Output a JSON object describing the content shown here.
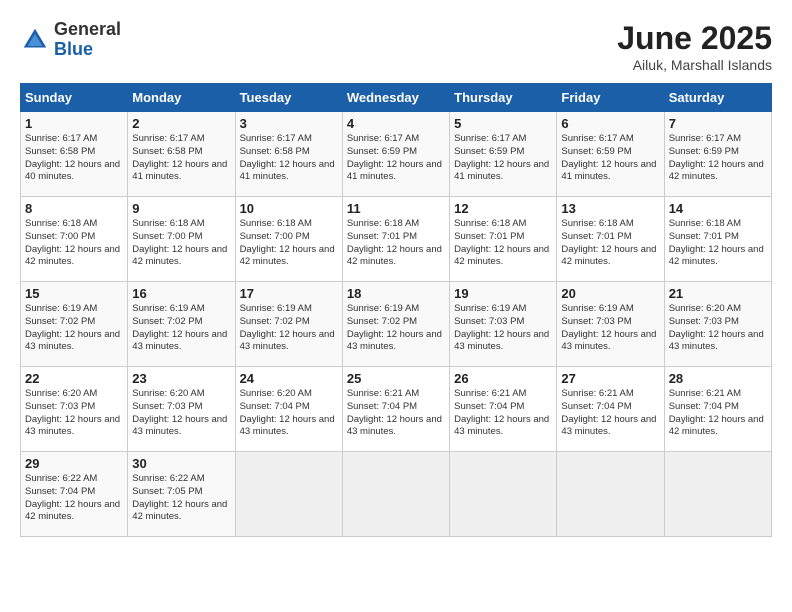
{
  "logo": {
    "general": "General",
    "blue": "Blue"
  },
  "header": {
    "title": "June 2025",
    "subtitle": "Ailuk, Marshall Islands"
  },
  "weekdays": [
    "Sunday",
    "Monday",
    "Tuesday",
    "Wednesday",
    "Thursday",
    "Friday",
    "Saturday"
  ],
  "weeks": [
    [
      {
        "day": "1",
        "sunrise": "6:17 AM",
        "sunset": "6:58 PM",
        "daylight": "12 hours and 40 minutes."
      },
      {
        "day": "2",
        "sunrise": "6:17 AM",
        "sunset": "6:58 PM",
        "daylight": "12 hours and 41 minutes."
      },
      {
        "day": "3",
        "sunrise": "6:17 AM",
        "sunset": "6:58 PM",
        "daylight": "12 hours and 41 minutes."
      },
      {
        "day": "4",
        "sunrise": "6:17 AM",
        "sunset": "6:59 PM",
        "daylight": "12 hours and 41 minutes."
      },
      {
        "day": "5",
        "sunrise": "6:17 AM",
        "sunset": "6:59 PM",
        "daylight": "12 hours and 41 minutes."
      },
      {
        "day": "6",
        "sunrise": "6:17 AM",
        "sunset": "6:59 PM",
        "daylight": "12 hours and 41 minutes."
      },
      {
        "day": "7",
        "sunrise": "6:17 AM",
        "sunset": "6:59 PM",
        "daylight": "12 hours and 42 minutes."
      }
    ],
    [
      {
        "day": "8",
        "sunrise": "6:18 AM",
        "sunset": "7:00 PM",
        "daylight": "12 hours and 42 minutes."
      },
      {
        "day": "9",
        "sunrise": "6:18 AM",
        "sunset": "7:00 PM",
        "daylight": "12 hours and 42 minutes."
      },
      {
        "day": "10",
        "sunrise": "6:18 AM",
        "sunset": "7:00 PM",
        "daylight": "12 hours and 42 minutes."
      },
      {
        "day": "11",
        "sunrise": "6:18 AM",
        "sunset": "7:01 PM",
        "daylight": "12 hours and 42 minutes."
      },
      {
        "day": "12",
        "sunrise": "6:18 AM",
        "sunset": "7:01 PM",
        "daylight": "12 hours and 42 minutes."
      },
      {
        "day": "13",
        "sunrise": "6:18 AM",
        "sunset": "7:01 PM",
        "daylight": "12 hours and 42 minutes."
      },
      {
        "day": "14",
        "sunrise": "6:18 AM",
        "sunset": "7:01 PM",
        "daylight": "12 hours and 42 minutes."
      }
    ],
    [
      {
        "day": "15",
        "sunrise": "6:19 AM",
        "sunset": "7:02 PM",
        "daylight": "12 hours and 43 minutes."
      },
      {
        "day": "16",
        "sunrise": "6:19 AM",
        "sunset": "7:02 PM",
        "daylight": "12 hours and 43 minutes."
      },
      {
        "day": "17",
        "sunrise": "6:19 AM",
        "sunset": "7:02 PM",
        "daylight": "12 hours and 43 minutes."
      },
      {
        "day": "18",
        "sunrise": "6:19 AM",
        "sunset": "7:02 PM",
        "daylight": "12 hours and 43 minutes."
      },
      {
        "day": "19",
        "sunrise": "6:19 AM",
        "sunset": "7:03 PM",
        "daylight": "12 hours and 43 minutes."
      },
      {
        "day": "20",
        "sunrise": "6:19 AM",
        "sunset": "7:03 PM",
        "daylight": "12 hours and 43 minutes."
      },
      {
        "day": "21",
        "sunrise": "6:20 AM",
        "sunset": "7:03 PM",
        "daylight": "12 hours and 43 minutes."
      }
    ],
    [
      {
        "day": "22",
        "sunrise": "6:20 AM",
        "sunset": "7:03 PM",
        "daylight": "12 hours and 43 minutes."
      },
      {
        "day": "23",
        "sunrise": "6:20 AM",
        "sunset": "7:03 PM",
        "daylight": "12 hours and 43 minutes."
      },
      {
        "day": "24",
        "sunrise": "6:20 AM",
        "sunset": "7:04 PM",
        "daylight": "12 hours and 43 minutes."
      },
      {
        "day": "25",
        "sunrise": "6:21 AM",
        "sunset": "7:04 PM",
        "daylight": "12 hours and 43 minutes."
      },
      {
        "day": "26",
        "sunrise": "6:21 AM",
        "sunset": "7:04 PM",
        "daylight": "12 hours and 43 minutes."
      },
      {
        "day": "27",
        "sunrise": "6:21 AM",
        "sunset": "7:04 PM",
        "daylight": "12 hours and 43 minutes."
      },
      {
        "day": "28",
        "sunrise": "6:21 AM",
        "sunset": "7:04 PM",
        "daylight": "12 hours and 42 minutes."
      }
    ],
    [
      {
        "day": "29",
        "sunrise": "6:22 AM",
        "sunset": "7:04 PM",
        "daylight": "12 hours and 42 minutes."
      },
      {
        "day": "30",
        "sunrise": "6:22 AM",
        "sunset": "7:05 PM",
        "daylight": "12 hours and 42 minutes."
      },
      null,
      null,
      null,
      null,
      null
    ]
  ]
}
